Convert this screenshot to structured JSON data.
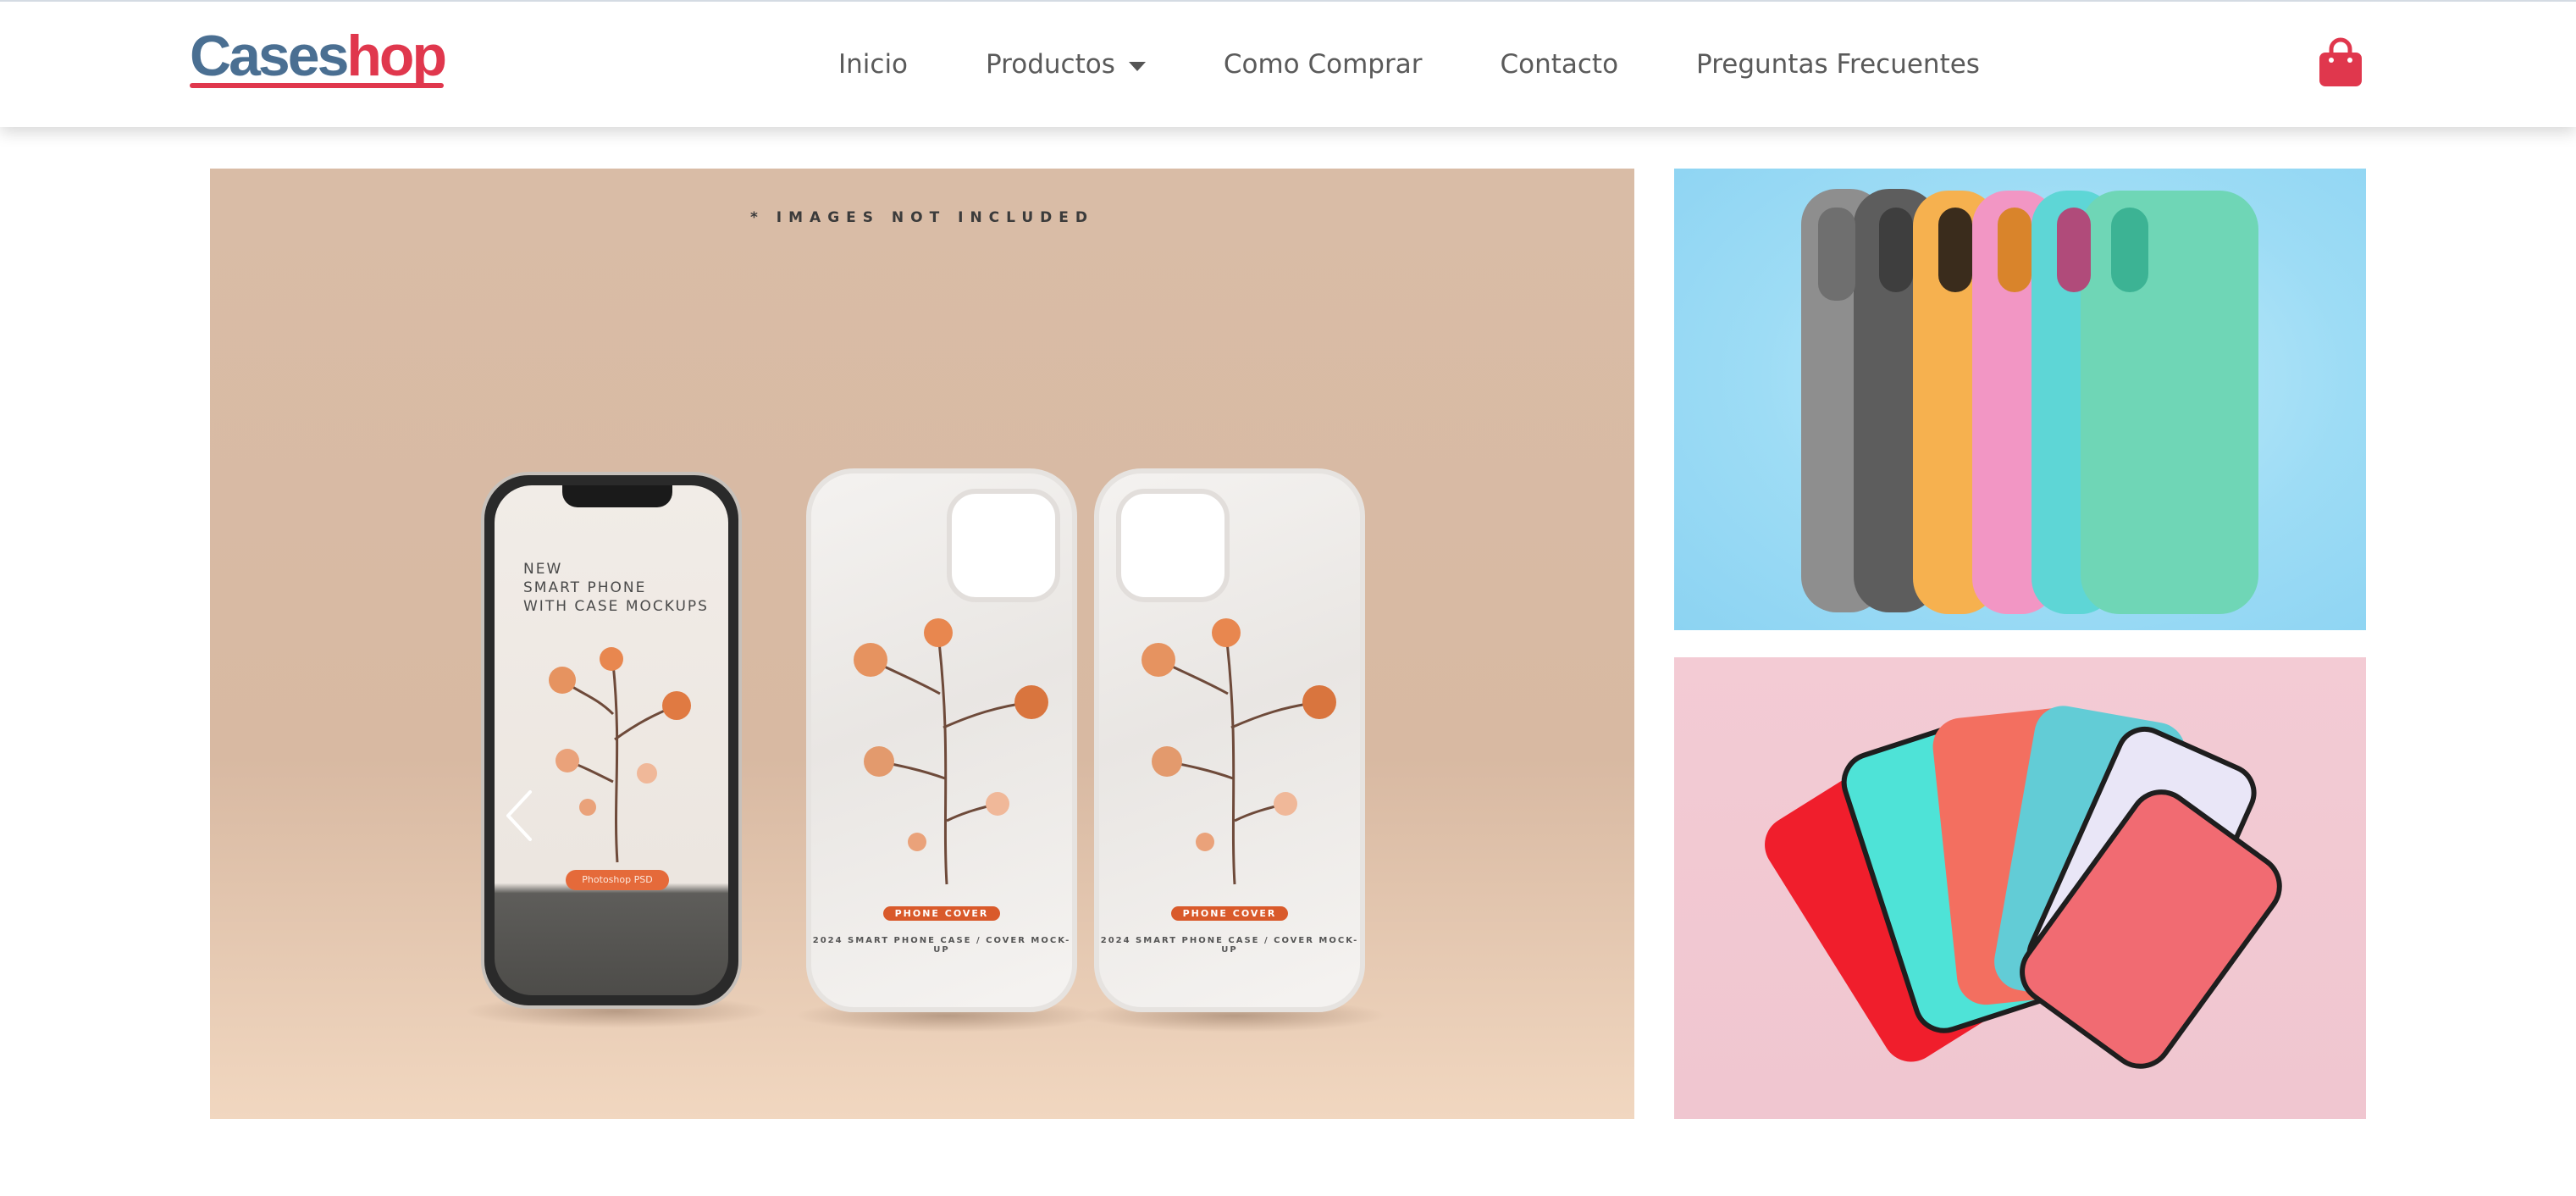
{
  "brand": {
    "name_main": "Cases",
    "name_accent": "hop"
  },
  "nav": {
    "items": [
      {
        "label": "Inicio"
      },
      {
        "label": "Productos"
      },
      {
        "label": "Como Comprar"
      },
      {
        "label": "Contacto"
      },
      {
        "label": "Preguntas Frecuentes"
      }
    ]
  },
  "icons": {
    "cart": "shopping-bag-icon",
    "prev": "chevron-left-icon",
    "next": "chevron-right-icon",
    "dropdown": "caret-down-icon"
  },
  "colors": {
    "brand_blue": "#4a6f92",
    "brand_red": "#e0374d",
    "nav_text": "#5a5a5a"
  },
  "carousel": {
    "caption": "* IMAGES NOT INCLUDED",
    "phone_title": "NEW\nSMART PHONE\nWITH CASE MOCKUPS",
    "phone_button": "Photoshop PSD",
    "case_label": "PHONE COVER",
    "case_subtitle": "2024 SMART PHONE CASE / COVER MOCK-UP"
  }
}
